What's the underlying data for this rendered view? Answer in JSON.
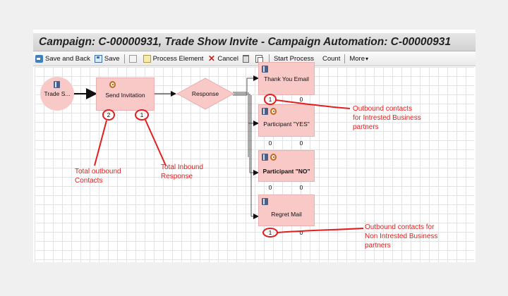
{
  "window": {
    "title": "Campaign: C-00000931, Trade Show Invite - Campaign Automation: C-00000931"
  },
  "toolbar": {
    "save_and_back": "Save and Back",
    "save": "Save",
    "process_element": "Process Element",
    "cancel": "Cancel",
    "start_process": "Start Process",
    "count": "Count",
    "more": "More",
    "more_arrow": "▾"
  },
  "flow": {
    "start_node": "Trade S...",
    "send_invitation": {
      "label": "Send Invitation",
      "outbound": "2",
      "inbound": "1"
    },
    "response": "Response",
    "branches": [
      {
        "label": "Thank You Email",
        "outbound": "1",
        "inbound": "0"
      },
      {
        "label": "Participant \"YES\"",
        "outbound": "0",
        "inbound": "0"
      },
      {
        "label": "Participant \"NO\"",
        "outbound": "0",
        "inbound": "0"
      },
      {
        "label": "Regret Mail",
        "outbound": "1",
        "inbound": "0"
      }
    ]
  },
  "annotations": {
    "outbound_interested": [
      "Outbound contacts",
      "for Intrested Business",
      "partners"
    ],
    "total_outbound": [
      "Total outbound",
      "Contacts"
    ],
    "total_inbound": [
      "Total Inbound",
      "Response"
    ],
    "outbound_non_interested": [
      "Outbound contacts for",
      "Non Intrested Business",
      "partners"
    ]
  },
  "colors": {
    "node_fill": "#f9c9c8",
    "annotation_red": "#e02020"
  }
}
